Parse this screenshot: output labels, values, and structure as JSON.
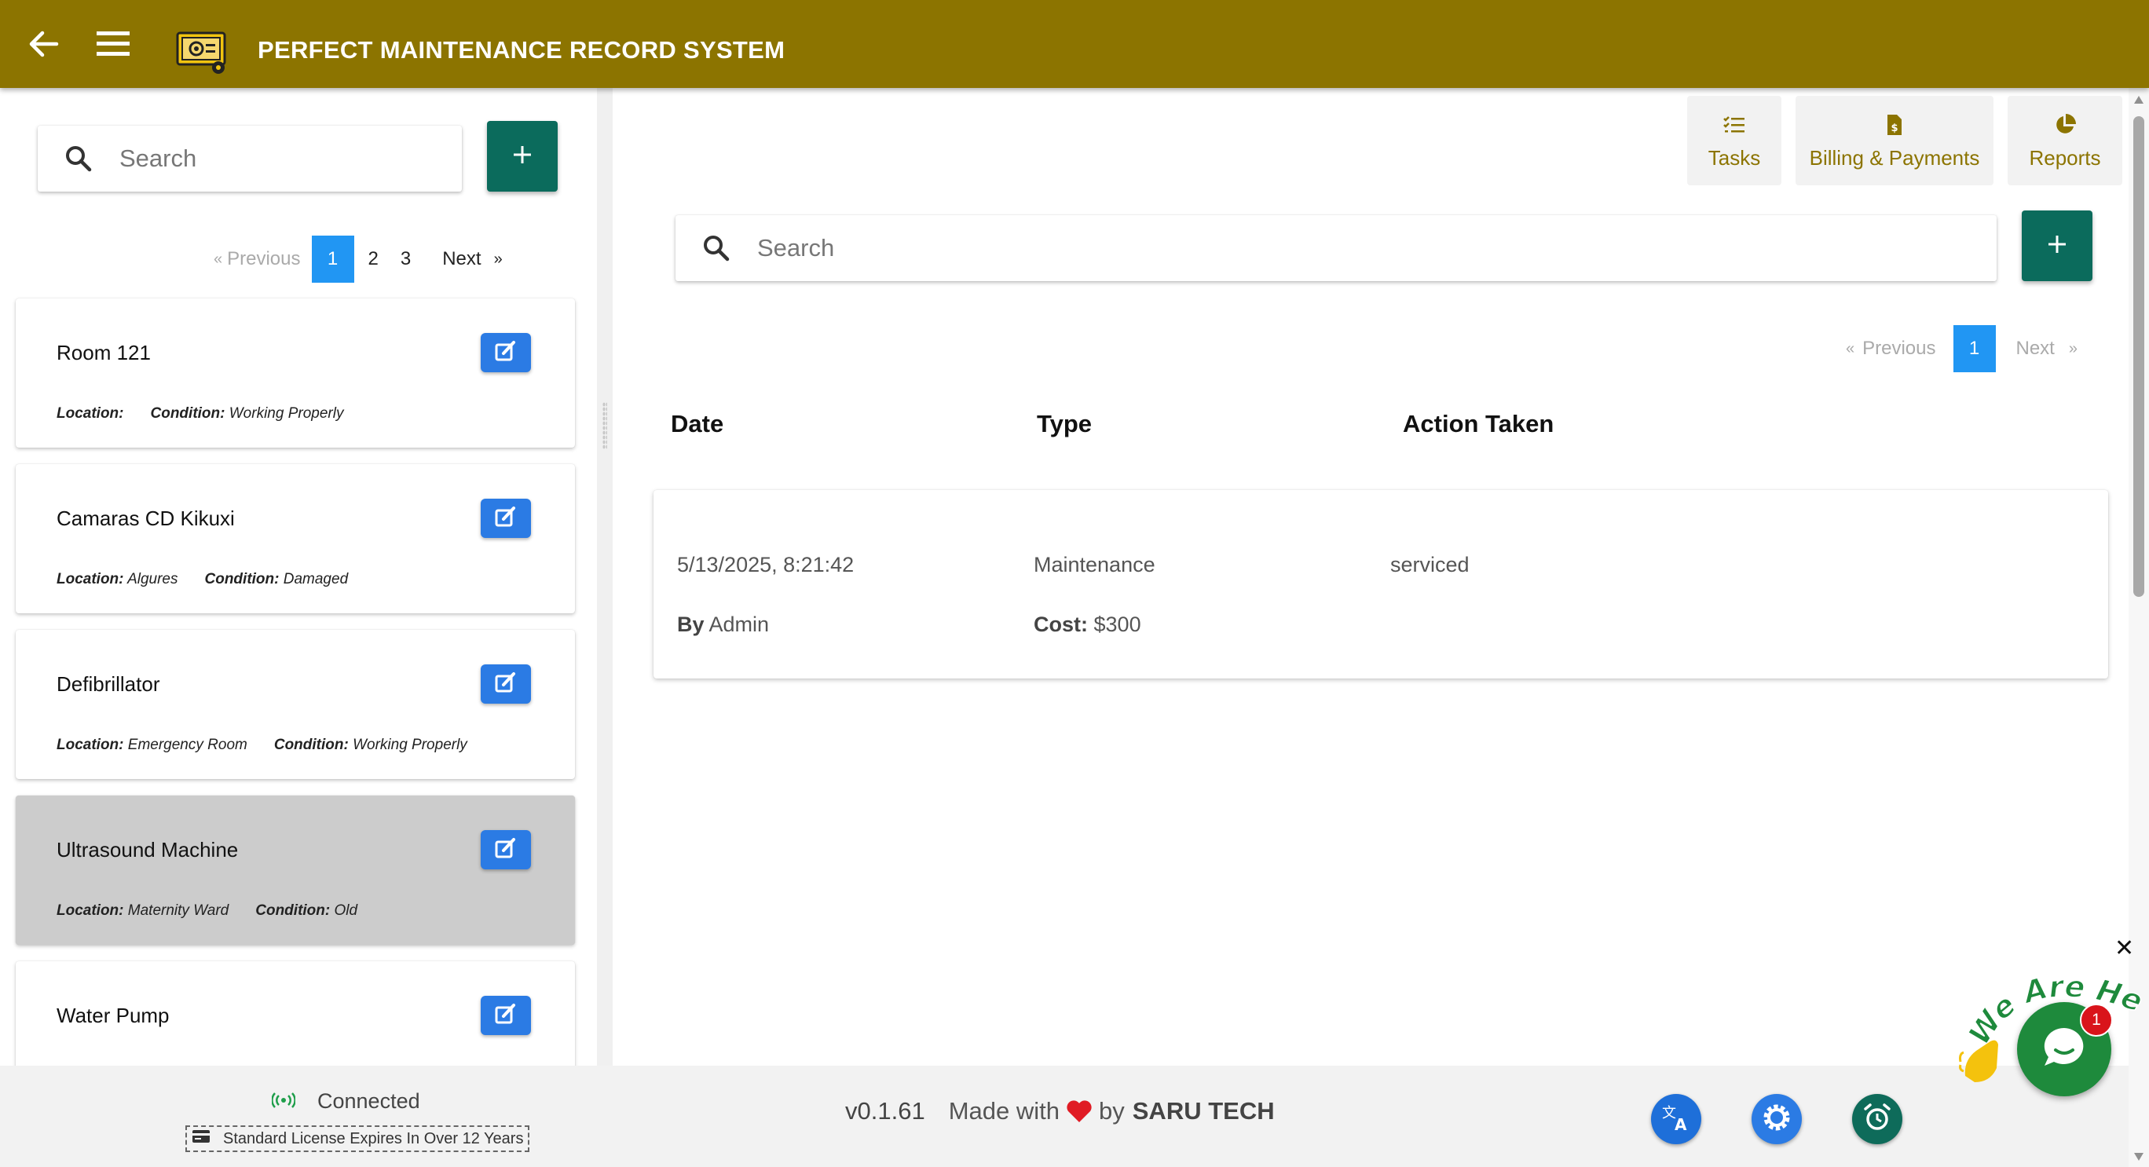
{
  "app": {
    "title": "PERFECT MAINTENANCE RECORD SYSTEM",
    "header_color": "#8c7400"
  },
  "icons": {
    "back": "arrow-left-icon",
    "menu": "hamburger-menu-icon",
    "logo": "app-logo-icon",
    "search": "search-icon",
    "add": "plus-icon",
    "edit": "edit-icon",
    "tasks": "task-list-icon",
    "billing": "invoice-dollar-icon",
    "reports": "pie-chart-icon",
    "connection": "wifi-signal-icon",
    "license": "card-icon",
    "translate": "translate-icon",
    "settings": "gear-icon",
    "alarm": "alarm-clock-icon",
    "chat": "chat-bubble-icon"
  },
  "left": {
    "search_placeholder": "Search",
    "pagination": {
      "prev_arrow": "«",
      "previous": "Previous",
      "pages": [
        "1",
        "2",
        "3"
      ],
      "active_page": "1",
      "next": "Next",
      "next_arrow": "»"
    },
    "labels": {
      "location": "Location:",
      "condition": "Condition:"
    },
    "items": [
      {
        "name": "Room 121",
        "location": "",
        "condition": "Working Properly",
        "selected": false
      },
      {
        "name": "Camaras CD Kikuxi",
        "location": "Algures",
        "condition": "Damaged",
        "selected": false
      },
      {
        "name": "Defibrillator",
        "location": "Emergency Room",
        "condition": "Working Properly",
        "selected": false
      },
      {
        "name": "Ultrasound Machine",
        "location": "Maternity Ward",
        "condition": "Old",
        "selected": true
      },
      {
        "name": "Water Pump",
        "location": "",
        "condition": "",
        "selected": false
      }
    ]
  },
  "right": {
    "toolbar": {
      "tasks": "Tasks",
      "billing": "Billing & Payments",
      "reports": "Reports"
    },
    "search_placeholder": "Search",
    "pagination": {
      "prev_arrow": "«",
      "previous": "Previous",
      "active_page": "1",
      "next": "Next",
      "next_arrow": "»"
    },
    "columns": {
      "date": "Date",
      "type": "Type",
      "action": "Action Taken"
    },
    "records": [
      {
        "date": "5/13/2025, 8:21:42",
        "type": "Maintenance",
        "action": "serviced",
        "by_label": "By",
        "by": "Admin",
        "cost_label": "Cost:",
        "cost": "$300"
      }
    ]
  },
  "footer": {
    "connection_status": "Connected",
    "license": "Standard License Expires In Over 12 Years",
    "version": "v0.1.61",
    "made_with": "Made with",
    "by": "by",
    "brand": "SARU TECH"
  },
  "chat": {
    "tagline": "We Are Here!",
    "badge_count": "1",
    "close": "✕"
  },
  "colors": {
    "accent_green": "#0b6b5c",
    "pager_active": "#2196f3",
    "edit_blue": "#2b7be4",
    "chat_green": "#1e8a3c",
    "translate_blue": "#1e6fd9",
    "settings_blue": "#2b7be4",
    "alarm_teal": "#0e6b5a"
  }
}
